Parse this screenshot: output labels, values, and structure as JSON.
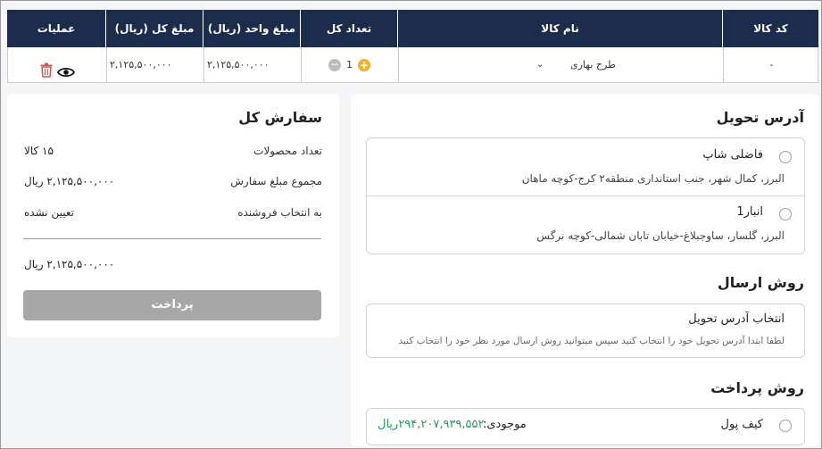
{
  "table": {
    "headers": {
      "code": "کد کالا",
      "name": "نام کالا",
      "qty": "تعداد کل",
      "unit_price": "مبلغ واحد (ریال)",
      "total": "مبلغ کل (ریال)",
      "actions": "عملیات"
    },
    "row": {
      "code": "-",
      "name": "طرح بهاری",
      "qty": "1",
      "unit_price": "۲,۱۲۵,۵۰۰,۰۰۰",
      "total": "۲,۱۲۵,۵۰۰,۰۰۰"
    }
  },
  "delivery": {
    "title": "آدرس تحویل",
    "addresses": [
      {
        "name": "فاضلی شاپ",
        "line": "البرز، کمال شهر، جنب استانداری منطقه۲ کرج-کوچه ماهان"
      },
      {
        "name": "انبار1",
        "line": "البرز، گلسار، ساوجبلاغ-خیابان تابان شمالی-کوچه نرگس"
      }
    ]
  },
  "shipping": {
    "title": "روش ارسال",
    "box_title": "انتخاب آدرس تحویل",
    "box_hint": "لطفا ابتدا آدرس تحویل خود را انتخاب کنید سپس میتوانید روش ارسال مورد نظر خود را انتخاب کنید"
  },
  "payment": {
    "title": "روش پرداخت",
    "wallet_label": "کیف پول",
    "balance_label": "موجودی:",
    "balance_value": "۲۹۴,۲۰۷,۹۳۹,۵۵۲ریال",
    "balance_color": "#1f9e5a"
  },
  "summary": {
    "title": "سفارش کل",
    "count_label": "تعداد محصولات",
    "count_value": "۱۵ کالا",
    "sum_label": "مجموع مبلغ سفارش",
    "sum_value": "۲,۱۲۵,۵۰۰,۰۰۰ ریال",
    "seller_label": "به انتخاب فروشنده",
    "seller_value": "تعیین نشده",
    "total_value": "۲,۱۲۵,۵۰۰,۰۰۰ ریال",
    "pay_button": "پرداخت"
  },
  "colors": {
    "header_bg": "#1c2c4c",
    "plus_button": "#f0b429",
    "delete_icon": "#d9534f",
    "pay_button_disabled": "#a7a7a7"
  }
}
